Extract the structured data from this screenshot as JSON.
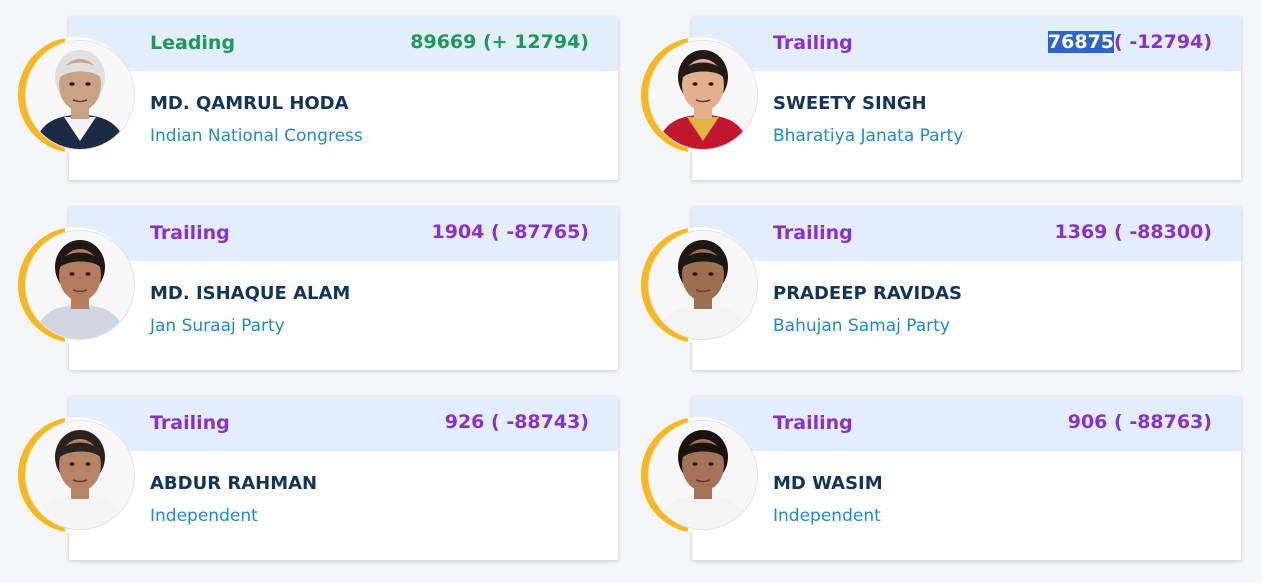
{
  "candidates": [
    {
      "status": "Leading",
      "status_kind": "leading",
      "votes_main": "89669",
      "votes_margin": " (+ 12794)",
      "votes_selected": false,
      "name": "MD. QAMRUL HODA",
      "party": "Indian National Congress",
      "photo": "portrait-man-gray-hair-glasses",
      "skin": "#c9a184",
      "hair": "#e0e0e0",
      "shirt": "#f2f2f2",
      "jacket": "#1d2a44"
    },
    {
      "status": "Trailing",
      "status_kind": "trailing",
      "votes_main": "76875",
      "votes_margin": "( -12794)",
      "votes_selected": true,
      "name": "SWEETY SINGH",
      "party": "Bharatiya Janata Party",
      "photo": "portrait-woman-red-saree",
      "skin": "#e3b08f",
      "hair": "#231a16",
      "shirt": "#e2b340",
      "jacket": "#c4162f"
    },
    {
      "status": "Trailing",
      "status_kind": "trailing",
      "votes_main": "1904",
      "votes_margin": " ( -87765)",
      "votes_selected": false,
      "name": "MD. ISHAQUE ALAM",
      "party": "Jan Suraaj Party",
      "photo": "portrait-man-mustache",
      "skin": "#b57d5d",
      "hair": "#201813",
      "shirt": "#cfd6df",
      "jacket": "#cfd6df"
    },
    {
      "status": "Trailing",
      "status_kind": "trailing",
      "votes_main": "1369",
      "votes_margin": " ( -88300)",
      "votes_selected": false,
      "name": "PRADEEP RAVIDAS",
      "party": "Bahujan Samaj Party",
      "photo": "portrait-man-white-shirt",
      "skin": "#9f6f52",
      "hair": "#1b1714",
      "shirt": "#f3f3f3",
      "jacket": "#f3f3f3"
    },
    {
      "status": "Trailing",
      "status_kind": "trailing",
      "votes_main": "926",
      "votes_margin": " ( -88743)",
      "votes_selected": false,
      "name": "ABDUR RAHMAN",
      "party": "Independent",
      "photo": "portrait-man-white-kurta",
      "skin": "#b78566",
      "hair": "#2a221e",
      "shirt": "#f4f4f4",
      "jacket": "#f4f4f4"
    },
    {
      "status": "Trailing",
      "status_kind": "trailing",
      "votes_main": "906",
      "votes_margin": " ( -88763)",
      "votes_selected": false,
      "name": "MD WASIM",
      "party": "Independent",
      "photo": "portrait-man-beard",
      "skin": "#a4735a",
      "hair": "#19130f",
      "shirt": "#f3f3f3",
      "jacket": "#f3f3f3"
    }
  ]
}
